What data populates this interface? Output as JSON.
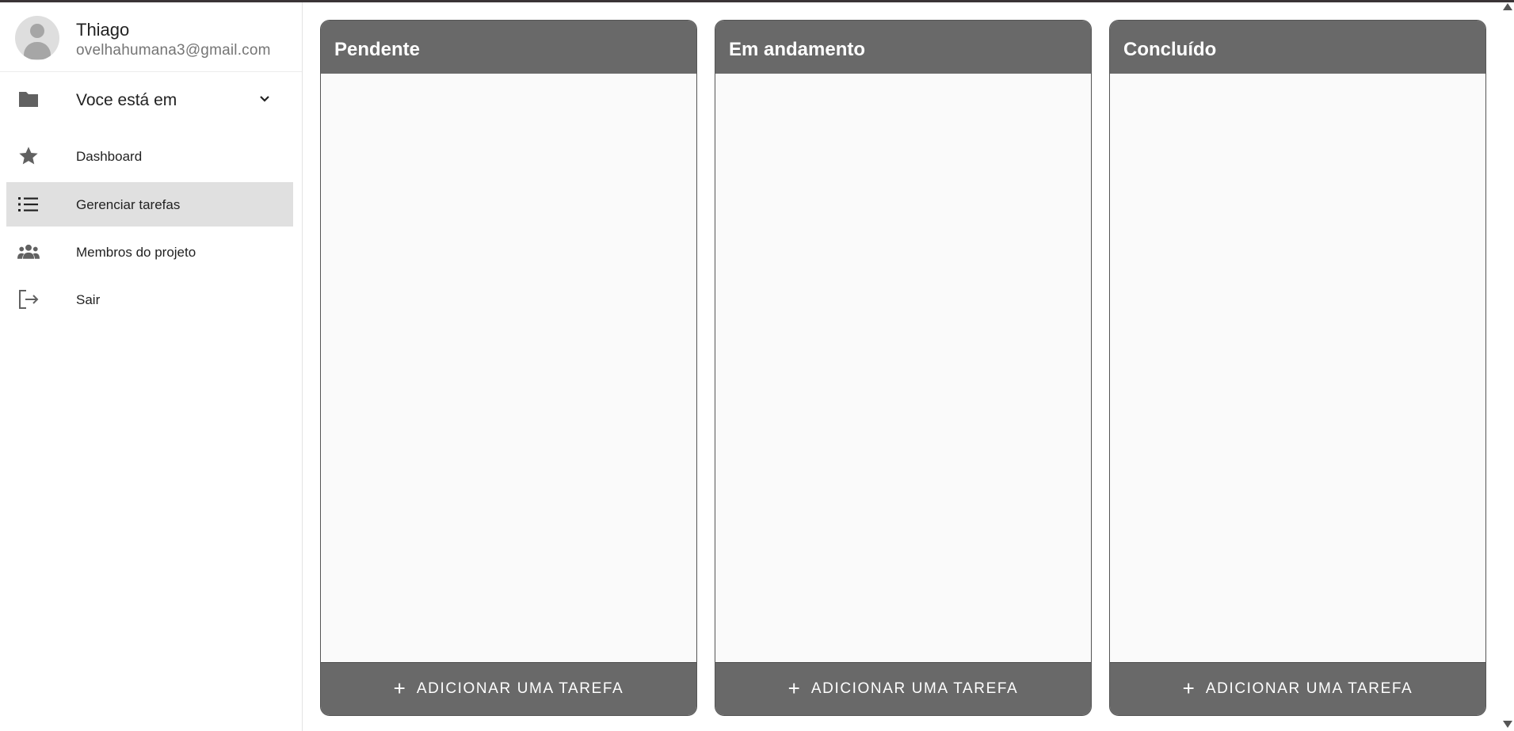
{
  "user": {
    "name": "Thiago",
    "email": "ovelhahumana3@gmail.com"
  },
  "sidebar": {
    "project_select": {
      "label": "Voce está em",
      "icon": "folder-icon"
    },
    "items": [
      {
        "label": "Dashboard",
        "icon": "star-icon",
        "active": false
      },
      {
        "label": "Gerenciar tarefas",
        "icon": "list-icon",
        "active": true
      },
      {
        "label": "Membros do projeto",
        "icon": "people-icon",
        "active": false
      },
      {
        "label": "Sair",
        "icon": "logout-icon",
        "active": false
      }
    ]
  },
  "board": {
    "columns": [
      {
        "title": "Pendente",
        "add_label": "ADICIONAR UMA TAREFA"
      },
      {
        "title": "Em andamento",
        "add_label": "ADICIONAR UMA TAREFA"
      },
      {
        "title": "Concluído",
        "add_label": "ADICIONAR UMA TAREFA"
      }
    ]
  },
  "colors": {
    "column_header": "#696969",
    "column_body": "#fafafa",
    "active_nav": "#e0e0e0",
    "icon": "#616161"
  }
}
